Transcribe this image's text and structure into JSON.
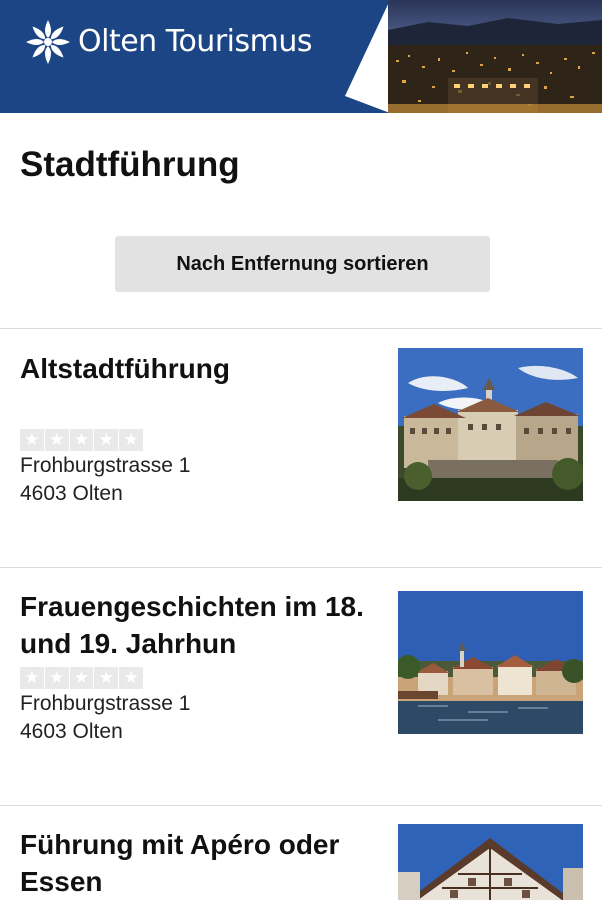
{
  "header": {
    "brand_name": "Olten Tourismus",
    "logo_icon": "sun-star-logo-icon",
    "brand_color": "#1b4585"
  },
  "page": {
    "title": "Stadtführung"
  },
  "sort": {
    "label": "Nach Entfernung sortieren"
  },
  "items": [
    {
      "title": "Altstadtführung",
      "street": "Frohburgstrasse 1",
      "city": "4603 Olten",
      "rating_stars": 5,
      "thumbnail_icon": "old-town-photo"
    },
    {
      "title": "Frauengeschichten im 18. und 19. Jahrhun",
      "street": "Frohburgstrasse 1",
      "city": "4603 Olten",
      "rating_stars": 5,
      "thumbnail_icon": "river-town-photo"
    },
    {
      "title": "Führung mit Apéro oder Essen",
      "thumbnail_icon": "timber-house-photo"
    }
  ]
}
